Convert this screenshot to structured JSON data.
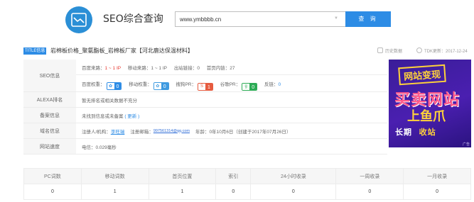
{
  "header": {
    "title": "SEO综合查询",
    "search_value": "www.ymbbbb.cn",
    "search_button": "查 询",
    "logo_icon": "chart-icon"
  },
  "title_row": {
    "tag": "TITLE信息",
    "text": "岩棉板价格_聚氨酯板_岩棉板厂家【河北鹿达保温材料】",
    "history_label": "历史数据",
    "tdk_label": "TDK更新：2017-12-24"
  },
  "seo": {
    "label": "SEO信息",
    "baidu_traffic_label": "百度来路：",
    "baidu_traffic_value": "1 ~ 1 IP",
    "mobile_traffic_label": "移动来路：",
    "mobile_traffic_value": "1 ~ 1 IP",
    "outbound_label": "出站链接：",
    "outbound_value": "0",
    "homepage_links_label": "首页内链：",
    "homepage_links_value": "27",
    "baidu_weight_label": "百度权重：",
    "baidu_weight_value": "0",
    "mobile_weight_label": "移动权重：",
    "mobile_weight_value": "0",
    "sogou_pr_label": "搜狗PR：",
    "sogou_pr_value": "1",
    "google_pr_label": "谷歌PR：",
    "google_pr_value": "0",
    "backlinks_label": "反链：",
    "backlinks_value": "0"
  },
  "alexa": {
    "label": "ALEXA排名",
    "value": "暂无排名或相关数据不充分"
  },
  "beian": {
    "label": "备案信息",
    "value": "未找到信息或未备案",
    "update_link": "( 更新 )"
  },
  "domain": {
    "label": "域名信息",
    "registrant_label": "注册人/机构：",
    "registrant_value": "李旺瑞",
    "email_label": "注册邮箱：",
    "email_value": "997561314@qq.com",
    "age_label": "年龄：",
    "age_value": "0年10月6日（创建于2017年07月26日）"
  },
  "speed": {
    "label": "网站速度",
    "value": "电信：0.029毫秒"
  },
  "ad": {
    "line1": "网站变现",
    "line2": "买卖网站",
    "line3": "上鱼爪",
    "line4a": "长期",
    "line4b": "收站",
    "tag": "广告"
  },
  "stats": {
    "headers": [
      "PC词数",
      "移动词数",
      "首页位置",
      "索引",
      "24小时收录",
      "一周收录",
      "一月收录"
    ],
    "values": [
      "0",
      "1",
      "1",
      "0",
      "0",
      "0",
      "0"
    ]
  },
  "colors": {
    "accent": "#2d8ce5",
    "red": "#e6362e",
    "ad_bg": "#4a1fb0"
  }
}
